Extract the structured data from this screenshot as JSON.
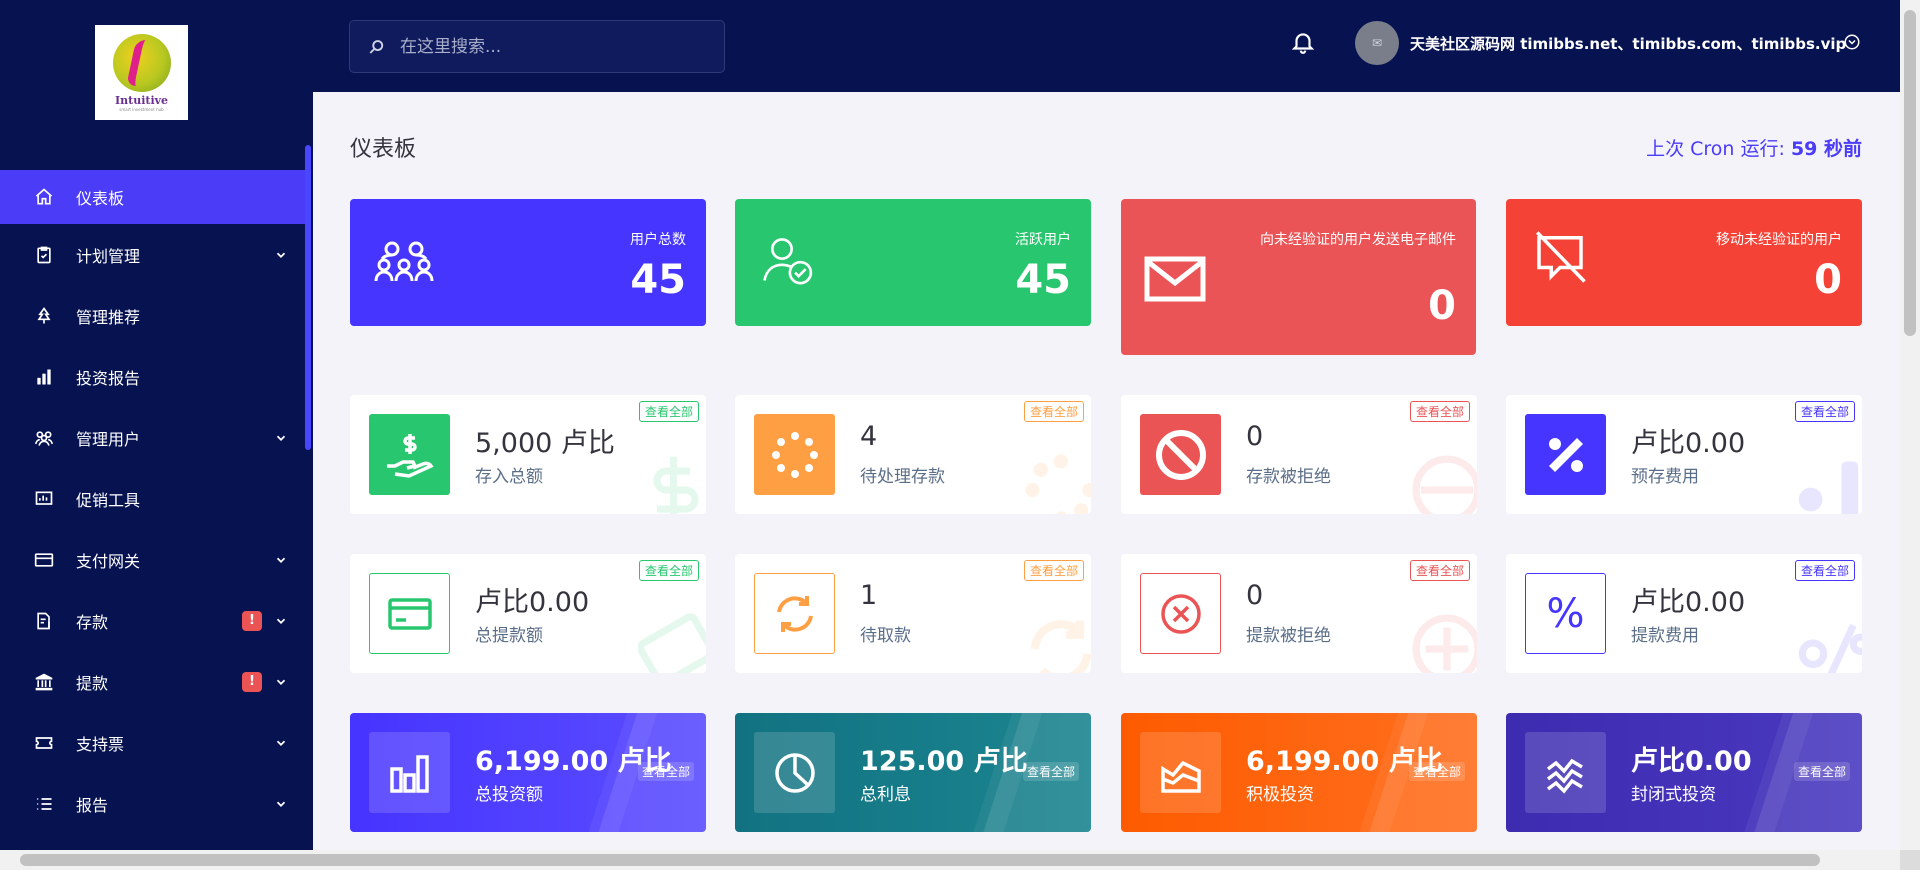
{
  "brand": {
    "logo_text": "Intuitive",
    "logo_sub": "smart investment hub"
  },
  "sidebar": {
    "items": [
      {
        "label": "仪表板",
        "icon": "home-icon",
        "active": true
      },
      {
        "label": "计划管理",
        "icon": "clipboard-check-icon",
        "has_children": true
      },
      {
        "label": "管理推荐",
        "icon": "tree-icon"
      },
      {
        "label": "投资报告",
        "icon": "bar-chart-icon"
      },
      {
        "label": "管理用户",
        "icon": "users-icon",
        "has_children": true
      },
      {
        "label": "促销工具",
        "icon": "presentation-icon"
      },
      {
        "label": "支付网关",
        "icon": "credit-card-icon",
        "has_children": true
      },
      {
        "label": "存款",
        "icon": "deposit-icon",
        "has_children": true,
        "badge": "!"
      },
      {
        "label": "提款",
        "icon": "bank-icon",
        "has_children": true,
        "badge": "!"
      },
      {
        "label": "支持票",
        "icon": "ticket-icon",
        "has_children": true
      },
      {
        "label": "报告",
        "icon": "list-icon",
        "has_children": true
      }
    ]
  },
  "header": {
    "search_placeholder": "在这里搜索...",
    "user_name": "天美社区源码网 timibbs.net、timibbs.com、timibbs.vip"
  },
  "page": {
    "title": "仪表板",
    "cron_label": "上次 Cron 运行:",
    "cron_value": "59 秒前"
  },
  "stats": [
    {
      "label": "用户总数",
      "value": "45",
      "color": "#4634ff",
      "icon": "users-group-icon"
    },
    {
      "label": "活跃用户",
      "value": "45",
      "color": "#28c76f",
      "icon": "user-check-icon"
    },
    {
      "label": "向未经验证的用户发送电子邮件",
      "value": "0",
      "color": "#eb5456",
      "icon": "envelope-icon"
    },
    {
      "label": "移动未经验证的用户",
      "value": "0",
      "color": "#f44336",
      "icon": "comment-slash-icon"
    }
  ],
  "view_all": "查看全部",
  "widgets_row1": [
    {
      "value": "5,000 卢比",
      "label": "存入总额",
      "color": "#28c76f",
      "icon": "hand-dollar-icon"
    },
    {
      "value": "4",
      "label": "待处理存款",
      "color": "#ff9f43",
      "icon": "spinner-icon"
    },
    {
      "value": "0",
      "label": "存款被拒绝",
      "color": "#ea5455",
      "icon": "ban-icon"
    },
    {
      "value": "卢比0.00",
      "label": "预存费用",
      "color": "#4634ff",
      "icon": "percent-icon"
    }
  ],
  "widgets_row2": [
    {
      "value": "卢比0.00",
      "label": "总提款额",
      "color": "#28c76f",
      "icon": "credit-card-icon"
    },
    {
      "value": "1",
      "label": "待取款",
      "color": "#ff9f43",
      "icon": "sync-icon"
    },
    {
      "value": "0",
      "label": "提款被拒绝",
      "color": "#ea5455",
      "icon": "times-circle-icon"
    },
    {
      "value": "卢比0.00",
      "label": "提款费用",
      "color": "#4634ff",
      "icon": "percentage-icon"
    }
  ],
  "widgets_row3": [
    {
      "value": "6,199.00 卢比",
      "label": "总投资额",
      "color": "#4634ff",
      "icon": "chart-bar-icon"
    },
    {
      "value": "125.00 卢比",
      "label": "总利息",
      "color": "#127281",
      "icon": "chart-pie-icon"
    },
    {
      "value": "6,199.00 卢比",
      "label": "积极投资",
      "color": "#fe5b00",
      "icon": "chart-area-icon"
    },
    {
      "value": "卢比0.00",
      "label": "封闭式投资",
      "color": "#3d2bb0",
      "icon": "chart-line-icon"
    }
  ]
}
